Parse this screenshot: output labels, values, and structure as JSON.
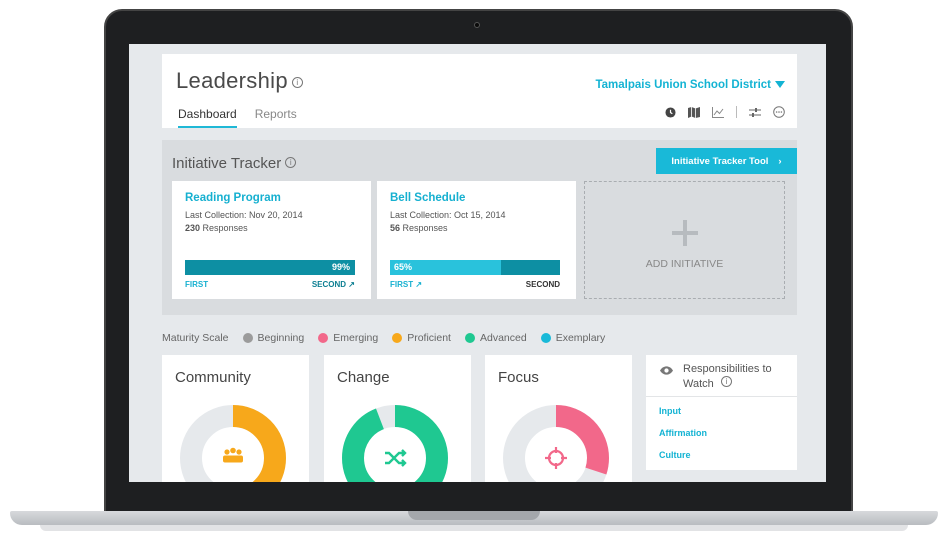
{
  "header": {
    "title": "Leadership",
    "district": "Tamalpais Union School District",
    "tabs": [
      {
        "label": "Dashboard",
        "active": true
      },
      {
        "label": "Reports",
        "active": false
      }
    ],
    "toolbar_icons": [
      "clock-icon",
      "map-icon",
      "line-chart-icon",
      "sliders-icon",
      "more-icon"
    ]
  },
  "tracker": {
    "title": "Initiative Tracker",
    "tool_button": "Initiative Tracker Tool",
    "initiatives": [
      {
        "name": "Reading Program",
        "last_collection": "Last Collection: Nov 20, 2014",
        "responses_count": "230",
        "responses_label": "Responses",
        "progress_label": "99%",
        "progress": 0.99,
        "first_label": "FIRST",
        "second_label": "SECOND"
      },
      {
        "name": "Bell Schedule",
        "last_collection": "Last Collection: Oct 15, 2014",
        "responses_count": "56",
        "responses_label": "Responses",
        "progress_label": "65%",
        "progress": 0.65,
        "first_label": "FIRST",
        "second_label": "SECOND"
      }
    ],
    "add_label": "ADD INITIATIVE"
  },
  "maturity": {
    "label": "Maturity Scale",
    "levels": [
      {
        "name": "Beginning",
        "color": "#9b9b9b"
      },
      {
        "name": "Emerging",
        "color": "#f2688a"
      },
      {
        "name": "Proficient",
        "color": "#f7a81b"
      },
      {
        "name": "Advanced",
        "color": "#1fc891"
      },
      {
        "name": "Exemplary",
        "color": "#19b9d8"
      }
    ]
  },
  "domains": [
    {
      "title": "Community",
      "color": "#f7a81b",
      "fraction": 0.5,
      "icon": "people-icon"
    },
    {
      "title": "Change",
      "color": "#1fc891",
      "fraction": 0.94,
      "icon": "shuffle-icon"
    },
    {
      "title": "Focus",
      "color": "#f2688a",
      "fraction": 0.3,
      "icon": "target-icon"
    }
  ],
  "responsibilities": {
    "title_line1": "Responsibilities to",
    "title_line2": "Watch",
    "items": [
      "Input",
      "Affirmation",
      "Culture"
    ]
  }
}
